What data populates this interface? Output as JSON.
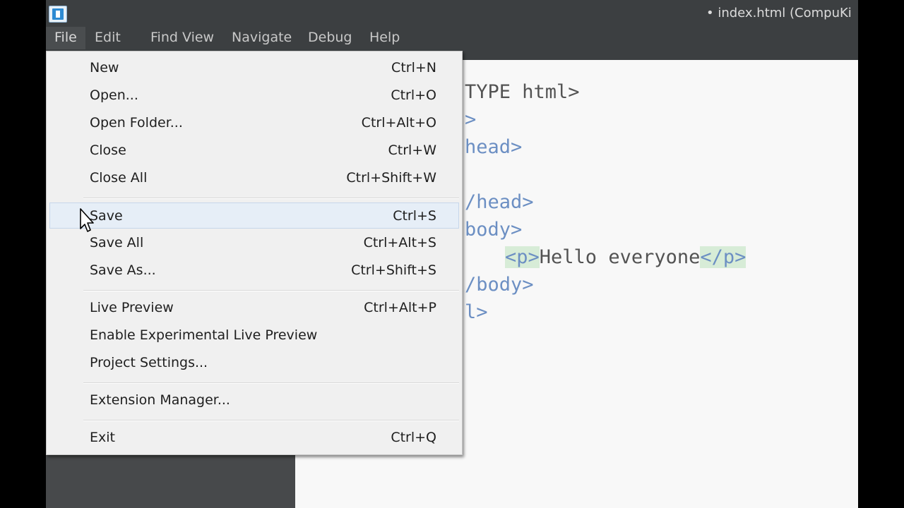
{
  "window": {
    "title": "• index.html (CompuKi"
  },
  "menubar": [
    {
      "label": "File"
    },
    {
      "label": "Edit"
    },
    {
      "label": "Find"
    },
    {
      "label": "View"
    },
    {
      "label": "Navigate"
    },
    {
      "label": "Debug"
    },
    {
      "label": "Help"
    }
  ],
  "file_menu": {
    "items": [
      {
        "label": "New",
        "shortcut": "Ctrl+N"
      },
      {
        "label": "Open...",
        "shortcut": "Ctrl+O"
      },
      {
        "label": "Open Folder...",
        "shortcut": "Ctrl+Alt+O"
      },
      {
        "label": "Close",
        "shortcut": "Ctrl+W"
      },
      {
        "label": "Close All",
        "shortcut": "Ctrl+Shift+W"
      },
      {
        "label": "Save",
        "shortcut": "Ctrl+S"
      },
      {
        "label": "Save All",
        "shortcut": "Ctrl+Alt+S"
      },
      {
        "label": "Save As...",
        "shortcut": "Ctrl+Shift+S"
      },
      {
        "label": "Live Preview",
        "shortcut": "Ctrl+Alt+P"
      },
      {
        "label": "Enable Experimental Live Preview",
        "shortcut": ""
      },
      {
        "label": "Project Settings...",
        "shortcut": ""
      },
      {
        "label": "Extension Manager...",
        "shortcut": ""
      },
      {
        "label": "Exit",
        "shortcut": "Ctrl+Q"
      }
    ],
    "selected_item": "Save"
  },
  "editor": {
    "lines": {
      "l1": "TYPE html>",
      "l2": ">",
      "l3": "head>",
      "l5": "/head>",
      "l6": "body>",
      "l7_open": "<p>",
      "l7_text": "Hello everyone",
      "l7_close": "</p>",
      "l8": "/body>",
      "l9": "l>"
    }
  },
  "colors": {
    "editor_bg": "#f8f8f8",
    "tag": "#6c8fc3",
    "tag_match_highlight": "#d7ecd7",
    "menu_bg": "#f0f0f0",
    "menu_selected": "#e6eef7",
    "app_chrome": "#3c3f41"
  }
}
